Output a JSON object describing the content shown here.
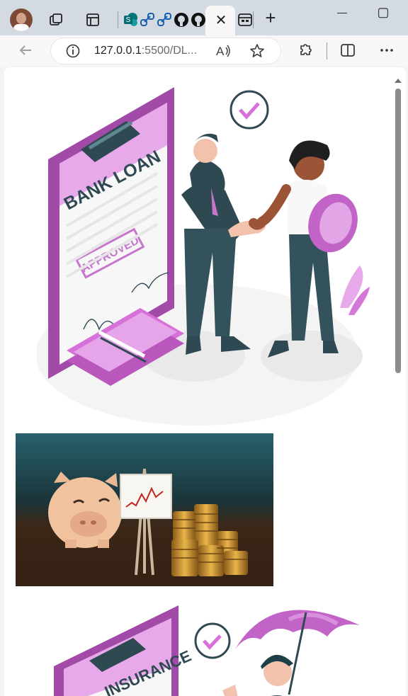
{
  "browser": {
    "tabs": [
      {
        "name": "tab-actions-icon"
      },
      {
        "name": "workspace-icon"
      },
      {
        "name": "sharepoint-icon"
      },
      {
        "name": "link-tab-1"
      },
      {
        "name": "link-tab-2"
      },
      {
        "name": "github-tab-1"
      },
      {
        "name": "github-tab-2"
      },
      {
        "name": "close-tab"
      },
      {
        "name": "app-tab"
      }
    ],
    "close_label": "✕",
    "new_tab_label": "+",
    "minimize_label": "—",
    "maximize_label": "▢"
  },
  "address": {
    "url_main": "127.0.0.1",
    "url_rest": ":5500/DL..."
  },
  "page": {
    "hero_sign": "BANK LOAN",
    "hero_stamp": "APPROVED",
    "bottom_sign": "INSURANCE",
    "chart_label": "trend-up-chart"
  },
  "colors": {
    "accent_purple": "#a14aa8",
    "light_purple": "#e8a9ea",
    "dark_teal": "#2f4953",
    "gold": "#d7a13b"
  }
}
